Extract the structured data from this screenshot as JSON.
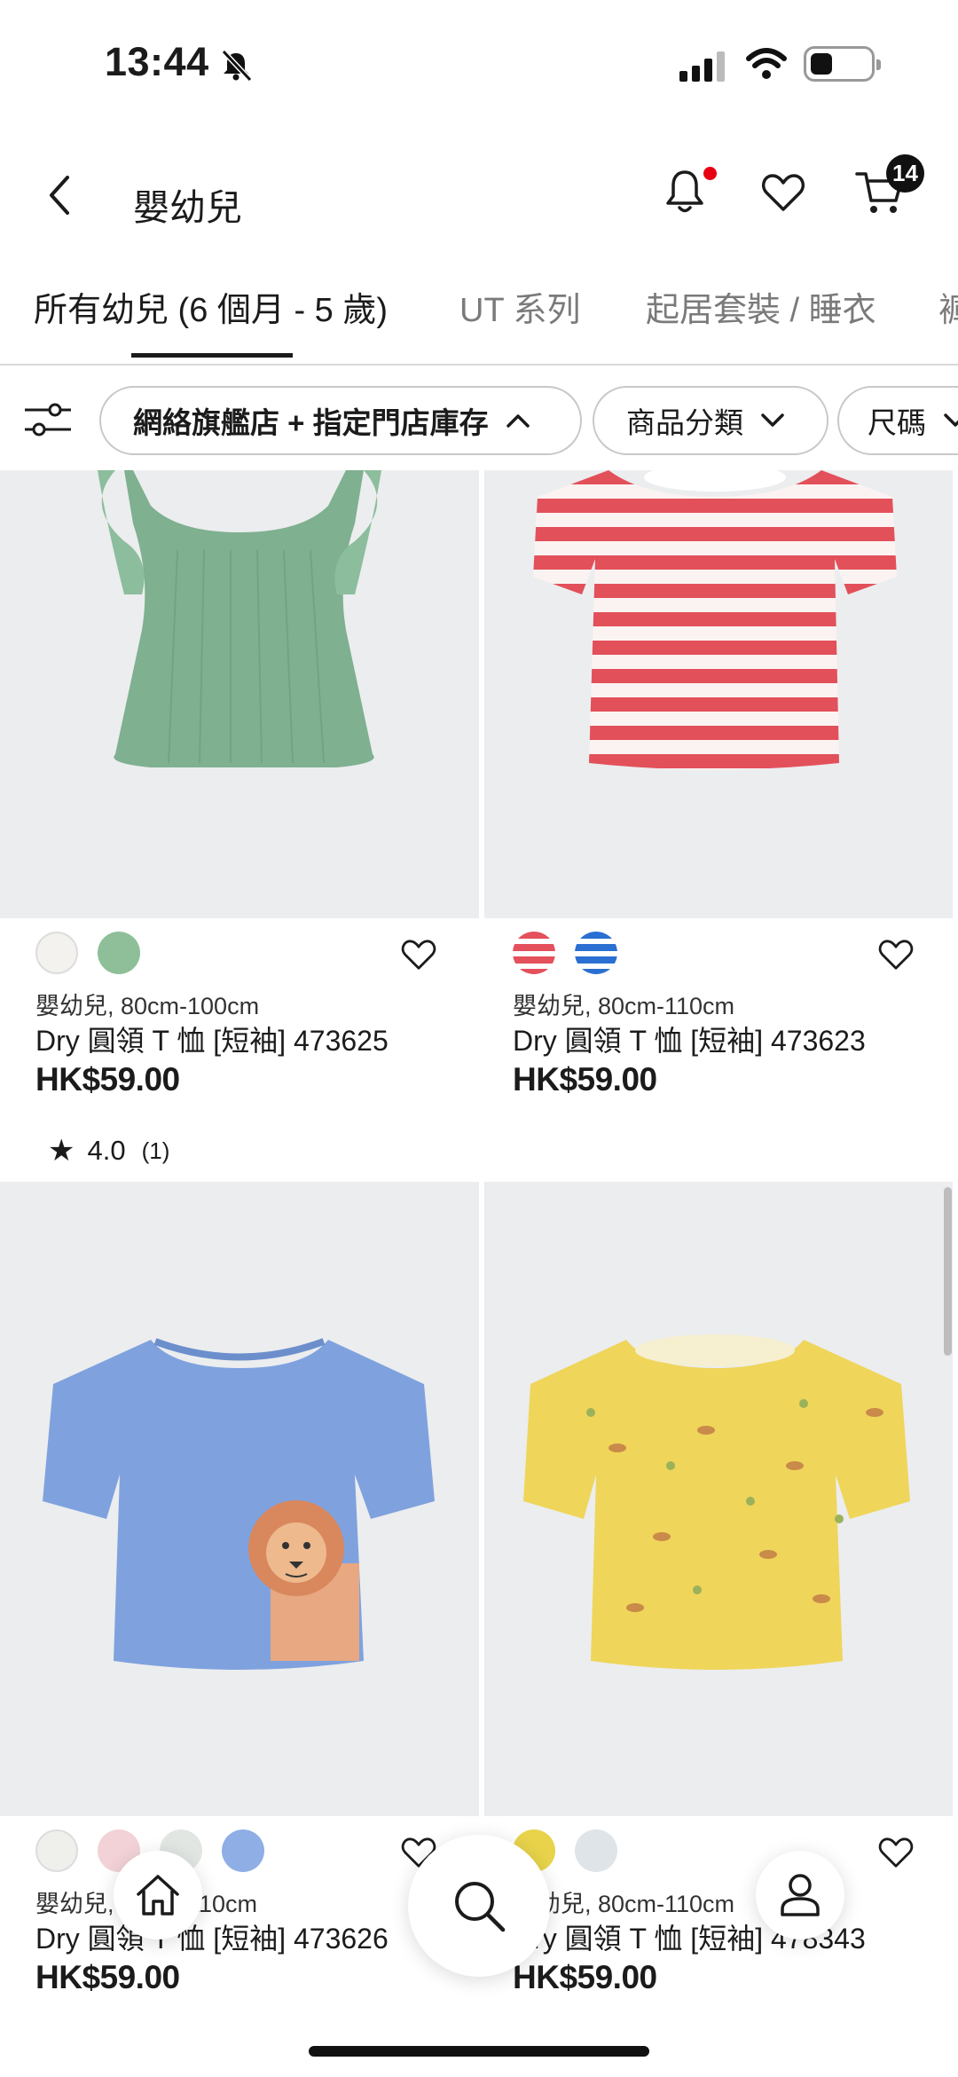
{
  "status_bar": {
    "time": "13:44"
  },
  "header": {
    "title": "嬰幼兒",
    "cart_count": "14"
  },
  "category_tabs": [
    {
      "label": "所有幼兒 (6 個月 - 5 歲)"
    },
    {
      "label": "UT 系列"
    },
    {
      "label": "起居套裝 / 睡衣"
    },
    {
      "label": "褲"
    }
  ],
  "filters": [
    {
      "label": "網絡旗艦店 + 指定門店庫存"
    },
    {
      "label": "商品分類"
    },
    {
      "label": "尺碼"
    }
  ],
  "products": [
    {
      "subtitle": "嬰幼兒, 80cm-100cm",
      "name": "Dry 圓領 T 恤 [短袖] 473625",
      "price": "HK$59.00",
      "rating": "4.0",
      "rating_count": "(1)",
      "swatches": [
        "#f3f2ee",
        "#8ebf98"
      ]
    },
    {
      "subtitle": "嬰幼兒, 80cm-110cm",
      "name": "Dry 圓領 T 恤 [短袖] 473623",
      "price": "HK$59.00",
      "swatches": [
        "#e4505b",
        "#2a6fd1"
      ]
    },
    {
      "subtitle": "嬰幼兒, 80cm-110cm",
      "name": "Dry 圓領 T 恤 [短袖] 473626",
      "price": "HK$59.00",
      "swatches": [
        "#efefec",
        "#f2d2d6",
        "#e2e6e3",
        "#8faee6"
      ]
    },
    {
      "subtitle": "嬰幼兒, 80cm-110cm",
      "name": "Dry 圓領 T 恤 [短袖] 478343",
      "price": "HK$59.00",
      "swatches": [
        "#e8d34a",
        "#dfe4e8"
      ]
    }
  ],
  "bottom_nav": [
    "home-icon",
    "search-icon",
    "account-icon"
  ],
  "colors": {
    "badge": "#111111",
    "notification_dot": "#e60012",
    "image_bg": "#ecedef"
  }
}
